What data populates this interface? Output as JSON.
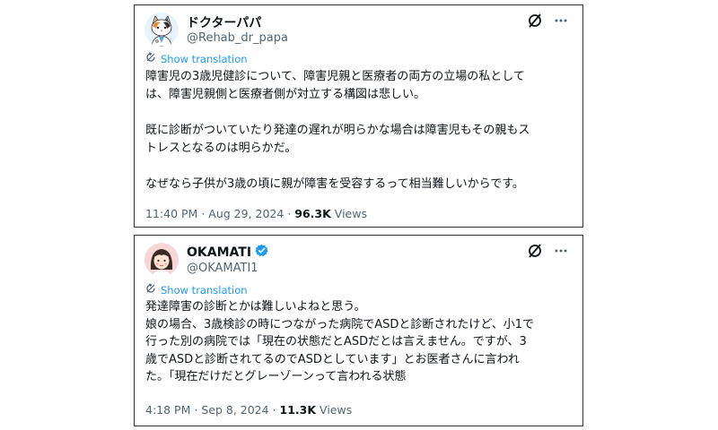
{
  "tweets": [
    {
      "display_name": "ドクターパパ",
      "handle": "@Rehab_dr_papa",
      "verified": false,
      "translate_label": "Show translation",
      "body": "障害児の3歳児健診について、障害児親と医療者の両方の立場の私として\nは、障害児親側と医療者側が対立する構図は悲しい。\n\n既に診断がついていたり発達の遅れが明らかな場合は障害児もその親もス\nトレスとなるのは明らかだ。\n\nなぜなら子供が3歳の頃に親が障害を受容するって相当難しいからです。",
      "time": "11:40 PM",
      "date": "Aug 29, 2024",
      "views_count": "96.3K",
      "views_label": "Views"
    },
    {
      "display_name": "OKAMATI",
      "handle": "@OKAMATI1",
      "verified": true,
      "translate_label": "Show translation",
      "body": "発達障害の診断とかは難しいよねと思う。\n娘の場合、3歳検診の時につながった病院でASDと診断されたけど、小1で\n行った別の病院では「現在の状態だとASDだとは言えません。ですが、3\n歳でASDと診断されてるのでASDとしています」とお医者さんに言われ\nた。「現在だけだとグレーゾーンって言われる状態",
      "time": "4:18 PM",
      "date": "Sep 8, 2024",
      "views_count": "11.3K",
      "views_label": "Views"
    }
  ],
  "separator": "·",
  "colors": {
    "link_blue": "#1d9bf0",
    "muted_gray": "#536471",
    "text": "#0f1419",
    "card_border": "#2f3336"
  },
  "icons": [
    "grok-icon",
    "more-icon",
    "translate-icon",
    "verified-badge-icon"
  ]
}
